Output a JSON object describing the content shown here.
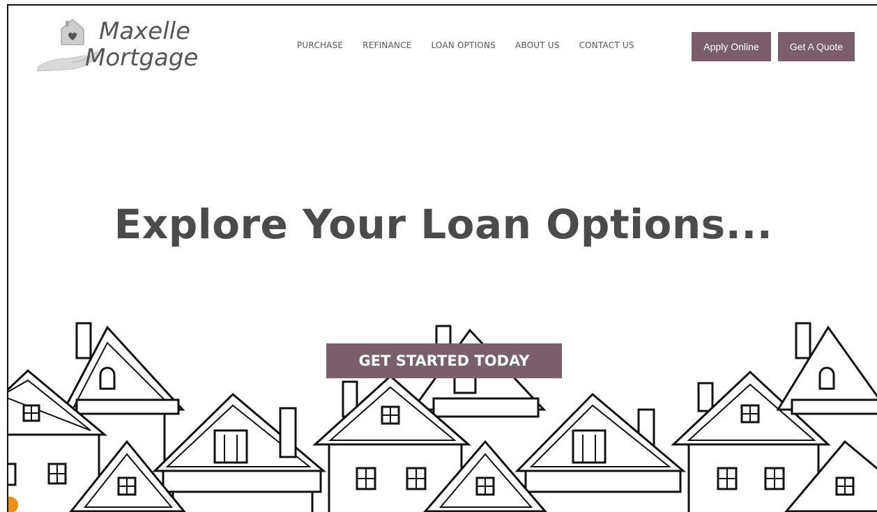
{
  "brand": {
    "line1": "Maxelle",
    "line2": "Mortgage"
  },
  "nav": {
    "items": [
      "PURCHASE",
      "REFINANCE",
      "LOAN OPTIONS",
      "ABOUT US",
      "CONTACT US"
    ]
  },
  "header_buttons": {
    "apply": "Apply Online",
    "quote": "Get A Quote"
  },
  "hero": {
    "title": "Explore Your Loan Options...",
    "cta": "GET STARTED TODAY"
  },
  "colors": {
    "accent": "#7b5e6b",
    "text": "#4b4b4b"
  }
}
